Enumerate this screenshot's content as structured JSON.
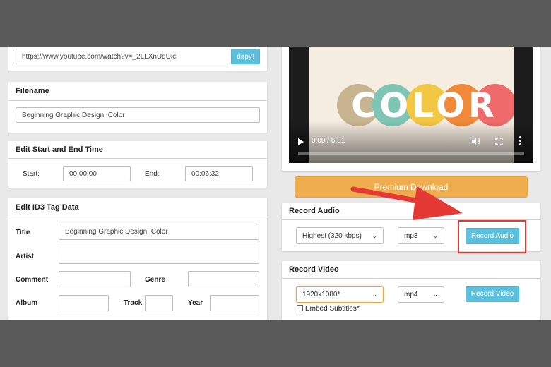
{
  "url_bar": {
    "value": "https://www.youtube.com/watch?v=_2LLXnUdUlc",
    "button_label": "dirpy!"
  },
  "filename": {
    "title": "Filename",
    "value": "Beginning Graphic Design: Color"
  },
  "edit_time": {
    "title": "Edit Start and End Time",
    "start_label": "Start:",
    "start_value": "00:00:00",
    "end_label": "End:",
    "end_value": "00:06:32"
  },
  "id3": {
    "title": "Edit ID3 Tag Data",
    "title_label": "Title",
    "title_value": "Beginning Graphic Design: Color",
    "artist_label": "Artist",
    "comment_label": "Comment",
    "genre_label": "Genre",
    "album_label": "Album",
    "track_label": "Track",
    "year_label": "Year"
  },
  "video": {
    "thumbnail_text": "COLOR",
    "time": "0:00 / 6:31",
    "circle_colors": [
      "#c8b48f",
      "#7ec6b3",
      "#f2c744",
      "#f08a3a",
      "#ef6a6a"
    ],
    "thumb_bg": "#f6ede1"
  },
  "premium": {
    "label": "Premium Download",
    "color": "#f0ad4e"
  },
  "record_audio": {
    "title": "Record Audio",
    "quality": "Highest (320 kbps)",
    "format": "mp3",
    "button_label": "Record Audio"
  },
  "record_video": {
    "title": "Record Video",
    "resolution": "1920x1080*",
    "format": "mp4",
    "button_label": "Record Video",
    "subtitles_label": "Embed Subtitles*"
  },
  "annotation": {
    "highlight_color": "#e53935"
  }
}
